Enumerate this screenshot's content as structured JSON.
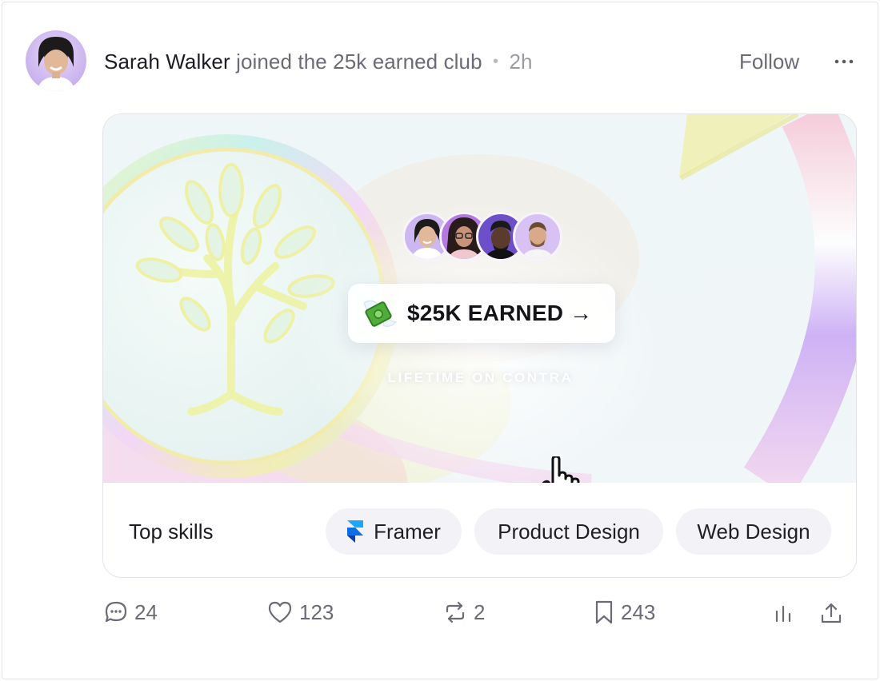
{
  "post": {
    "author": "Sarah Walker",
    "action": "joined the 25k earned club",
    "separator": "•",
    "time": "2h",
    "follow_label": "Follow",
    "more_icon": "more-horizontal-icon"
  },
  "card": {
    "earned_label": "$25K EARNED →",
    "earned_icon": "money-with-wings-icon",
    "subtitle": "LIFETIME ON CONTRA",
    "skills_title": "Top skills",
    "skills": [
      {
        "label": "Framer",
        "icon": "framer-icon"
      },
      {
        "label": "Product Design"
      },
      {
        "label": "Web Design"
      }
    ]
  },
  "stats": {
    "comments": "24",
    "likes": "123",
    "reposts": "2",
    "bookmarks": "243"
  },
  "colors": {
    "accent_text": "#1c1c22",
    "muted_text": "#6b6b77",
    "chip_bg": "#f3f3f7",
    "avatar_bg": "#c9b2ee"
  }
}
